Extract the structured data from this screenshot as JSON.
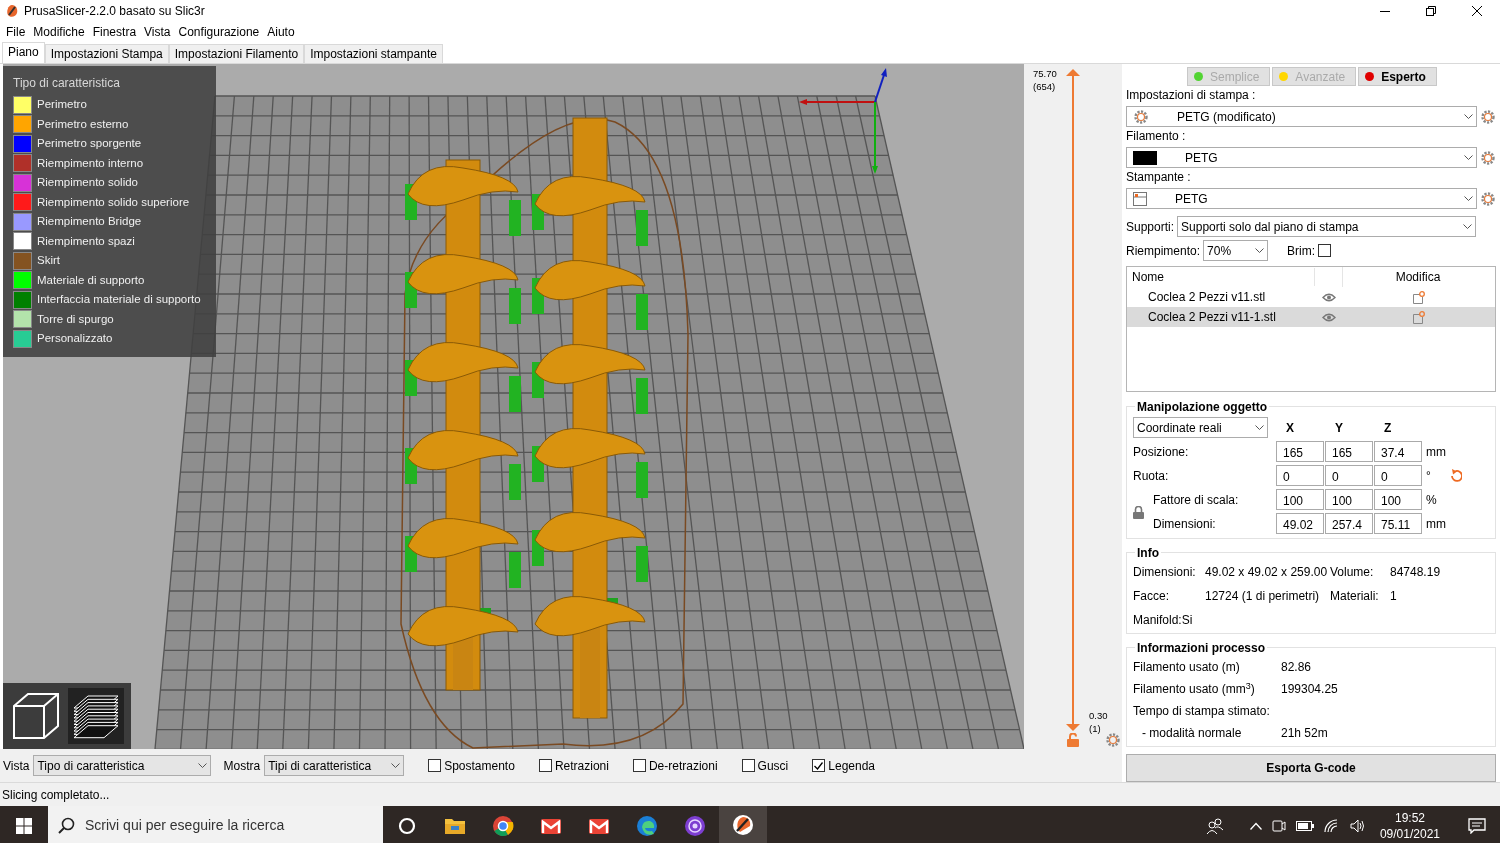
{
  "window": {
    "title": "PrusaSlicer-2.2.0 basato su Slic3r"
  },
  "menu": [
    "File",
    "Modifiche",
    "Finestra",
    "Vista",
    "Configurazione",
    "Aiuto"
  ],
  "tabs": [
    {
      "label": "Piano",
      "selected": true
    },
    {
      "label": "Impostazioni Stampa",
      "selected": false
    },
    {
      "label": "Impostazioni Filamento",
      "selected": false
    },
    {
      "label": "Impostazioni stampante",
      "selected": false
    }
  ],
  "legend": {
    "title": "Tipo di caratteristica",
    "items": [
      {
        "label": "Perimetro",
        "color": "#ffff66"
      },
      {
        "label": "Perimetro esterno",
        "color": "#ffa500"
      },
      {
        "label": "Perimetro sporgente",
        "color": "#0000ff"
      },
      {
        "label": "Riempimento interno",
        "color": "#b03029"
      },
      {
        "label": "Riempimento solido",
        "color": "#d732d7"
      },
      {
        "label": "Riempimento solido superiore",
        "color": "#ff1a1a"
      },
      {
        "label": "Riempimento Bridge",
        "color": "#9999ff"
      },
      {
        "label": "Riempimento spazi",
        "color": "#ffffff"
      },
      {
        "label": "Skirt",
        "color": "#845321"
      },
      {
        "label": "Materiale di supporto",
        "color": "#00ff00"
      },
      {
        "label": "Interfaccia materiale di supporto",
        "color": "#008000"
      },
      {
        "label": "Torre di spurgo",
        "color": "#b3e3ab"
      },
      {
        "label": "Personalizzato",
        "color": "#28cc94"
      }
    ]
  },
  "layer_slider": {
    "top_value": "75.70",
    "top_layer": "(654)",
    "bottom_value": "0.30",
    "bottom_layer": "(1)",
    "thumbs": [
      {
        "level": 1
      },
      {
        "level": 0
      }
    ]
  },
  "modes": [
    {
      "label": "Semplice",
      "color": "#52d433",
      "selected": false
    },
    {
      "label": "Avanzate",
      "color": "#ffd700",
      "selected": false
    },
    {
      "label": "Esperto",
      "color": "#e00000",
      "selected": true
    }
  ],
  "print_settings": {
    "label": "Impostazioni di stampa :",
    "value": "PETG (modificato)"
  },
  "filament": {
    "label": "Filamento :",
    "value": "PETG",
    "color": "#000000"
  },
  "printer": {
    "label": "Stampante :",
    "value": "PETG"
  },
  "supports": {
    "label": "Supporti:",
    "value": "Supporti solo dal piano di stampa"
  },
  "infill": {
    "label": "Riempimento:",
    "value": "70%"
  },
  "brim": {
    "label": "Brim:",
    "checked": false
  },
  "objects": {
    "columns": [
      "Nome",
      "Modifica"
    ],
    "rows": [
      {
        "name": "Coclea 2 Pezzi v11.stl",
        "selected": false
      },
      {
        "name": "Coclea 2 Pezzi v11-1.stl",
        "selected": true
      }
    ]
  },
  "manipulation": {
    "title": "Manipolazione oggetto",
    "coordinates": "Coordinate reali",
    "axes": [
      "X",
      "Y",
      "Z"
    ],
    "rows": [
      {
        "kind": "position",
        "label": "Posizione:",
        "values": [
          "165",
          "165",
          "37.4"
        ],
        "unit": "mm"
      },
      {
        "kind": "rotation",
        "label": "Ruota:",
        "values": [
          "0",
          "0",
          "0"
        ],
        "unit": "°"
      },
      {
        "kind": "scale",
        "label": "Fattore di scala:",
        "values": [
          "100",
          "100",
          "100"
        ],
        "unit": "%"
      },
      {
        "kind": "size",
        "label": "Dimensioni:",
        "values": [
          "49.02",
          "257.4",
          "75.11"
        ],
        "unit": "mm"
      }
    ]
  },
  "info": {
    "title": "Info",
    "fields": [
      {
        "label": "Dimensioni:",
        "value": "49.02 x 49.02 x 259.00"
      },
      {
        "label": "Volume:",
        "value": "84748.19"
      },
      {
        "label": "Facce:",
        "value": "12724 (1 di perimetri)"
      },
      {
        "label": "Materiali:",
        "value": "1"
      }
    ],
    "manifold": {
      "label": "Manifold:",
      "value": "Si"
    }
  },
  "process": {
    "title": "Informazioni processo",
    "rows": [
      {
        "kind": "plain",
        "label": "Filamento usato (m)",
        "value": "82.86"
      },
      {
        "kind": "plain",
        "label": "Filamento usato (mm$^{3}$)",
        "value": "199304.25"
      },
      {
        "kind": "header",
        "label": "Tempo di stampa stimato:"
      },
      {
        "kind": "sub",
        "label": "- modalità normale",
        "value": "21h 52m"
      }
    ]
  },
  "export_button": "Esporta G-code",
  "bottom_bar": {
    "view": {
      "label": "Vista",
      "value": "Tipo di caratteristica"
    },
    "show": {
      "label": "Mostra",
      "value": "Tipi di caratteristica"
    },
    "options": [
      {
        "label": "Spostamento",
        "checked": false
      },
      {
        "label": "Retrazioni",
        "checked": false
      },
      {
        "label": "De-retrazioni",
        "checked": false
      },
      {
        "label": "Gusci",
        "checked": false
      },
      {
        "label": "Legenda",
        "checked": true
      }
    ]
  },
  "status_bar": "Slicing completato...",
  "taskbar": {
    "search_placeholder": "Scrivi qui per eseguire la ricerca",
    "time": "19:52",
    "date": "09/01/2021",
    "apps": [
      {
        "kind": "cortana",
        "selected": false
      },
      {
        "kind": "folder",
        "selected": false
      },
      {
        "kind": "chrome",
        "selected": false
      },
      {
        "kind": "mail",
        "selected": false
      },
      {
        "kind": "mail",
        "selected": false
      },
      {
        "kind": "edge",
        "selected": false
      },
      {
        "kind": "tor",
        "selected": false
      },
      {
        "kind": "slicer",
        "selected": true
      }
    ]
  }
}
